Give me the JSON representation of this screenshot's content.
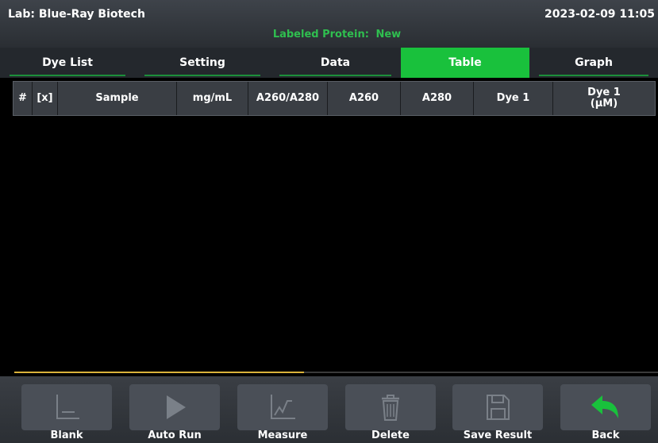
{
  "header": {
    "lab": "Lab: Blue-Ray Biotech",
    "subtitle_prefix": "Labeled Protein:",
    "subtitle_value": "New",
    "datetime": "2023-02-09 11:05"
  },
  "tabs": [
    {
      "label": "Dye List",
      "active": false
    },
    {
      "label": "Setting",
      "active": false
    },
    {
      "label": "Data",
      "active": false
    },
    {
      "label": "Table",
      "active": true
    },
    {
      "label": "Graph",
      "active": false
    }
  ],
  "table": {
    "columns": [
      "#",
      "[x]",
      "Sample",
      "mg/mL",
      "A260/A280",
      "A260",
      "A280",
      "Dye 1",
      "Dye 1\n(μM)"
    ],
    "rows": []
  },
  "progress": {
    "fraction": 0.45
  },
  "buttons": [
    {
      "label": "Blank",
      "icon": "blank-icon"
    },
    {
      "label": "Auto Run",
      "icon": "play-icon"
    },
    {
      "label": "Measure",
      "icon": "measure-chart-icon"
    },
    {
      "label": "Delete",
      "icon": "trash-icon"
    },
    {
      "label": "Save Result",
      "icon": "save-icon"
    },
    {
      "label": "Back",
      "icon": "back-arrow-icon"
    }
  ],
  "colors": {
    "accent_green": "#19c13c",
    "subtitle_green": "#2fbf4f",
    "progress_gold": "#d9b23a"
  }
}
